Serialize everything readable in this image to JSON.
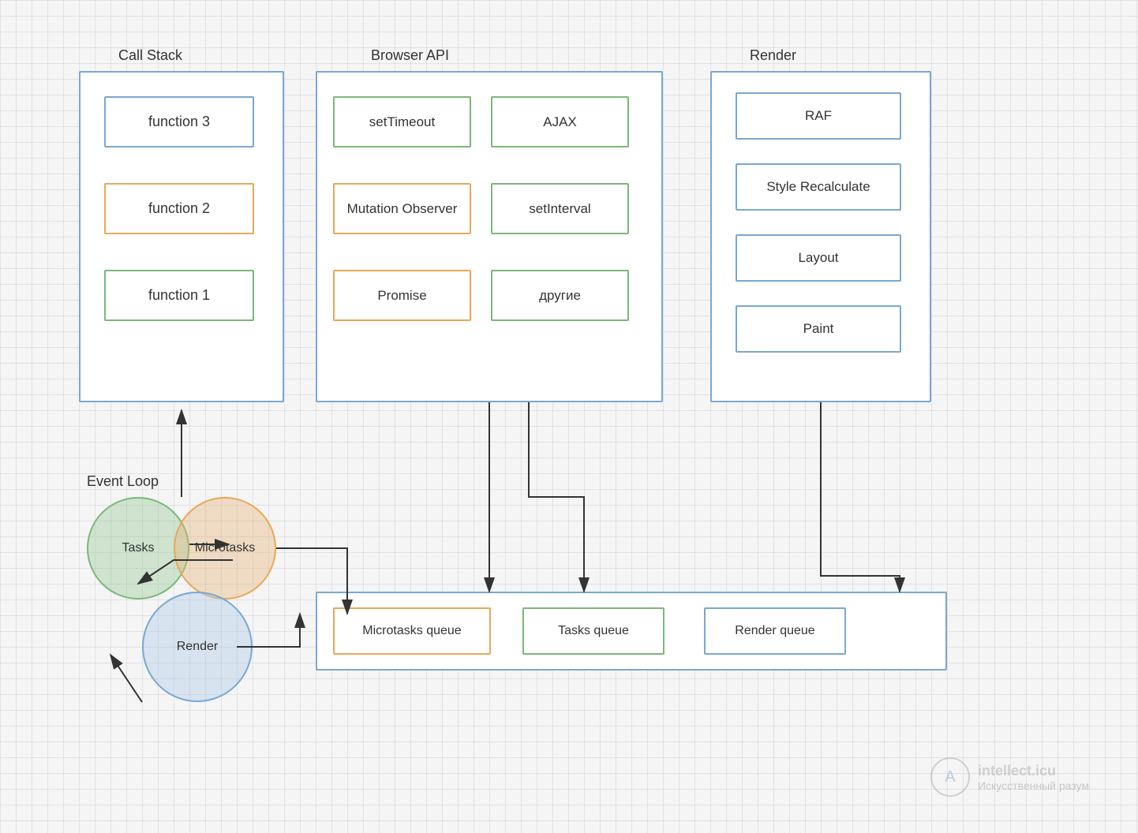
{
  "labels": {
    "callstack": "Call Stack",
    "browserapi": "Browser API",
    "render": "Render",
    "eventloop": "Event Loop"
  },
  "callstack": {
    "items": [
      {
        "label": "function 3",
        "type": "blue"
      },
      {
        "label": "function 2",
        "type": "orange"
      },
      {
        "label": "function 1",
        "type": "green"
      }
    ]
  },
  "browserapi": {
    "items": [
      {
        "label": "setTimeout",
        "type": "green",
        "col": 0,
        "row": 0
      },
      {
        "label": "AJAX",
        "type": "green",
        "col": 1,
        "row": 0
      },
      {
        "label": "Mutation Observer",
        "type": "orange",
        "col": 0,
        "row": 1
      },
      {
        "label": "setInterval",
        "type": "green",
        "col": 1,
        "row": 1
      },
      {
        "label": "Promise",
        "type": "orange",
        "col": 0,
        "row": 2
      },
      {
        "label": "другие",
        "type": "green",
        "col": 1,
        "row": 2
      }
    ]
  },
  "render": {
    "items": [
      {
        "label": "RAF",
        "type": "blue"
      },
      {
        "label": "Style Recalculate",
        "type": "blue"
      },
      {
        "label": "Layout",
        "type": "blue"
      },
      {
        "label": "Paint",
        "type": "blue"
      }
    ]
  },
  "eventloop": {
    "tasks": "Tasks",
    "microtasks": "Microtasks",
    "render": "Render"
  },
  "queues": {
    "microtasks": "Microtasks queue",
    "tasks": "Tasks queue",
    "render": "Render queue"
  },
  "watermark": {
    "logo": "A",
    "name": "intellect.icu",
    "subtitle": "Искусственный разум"
  }
}
